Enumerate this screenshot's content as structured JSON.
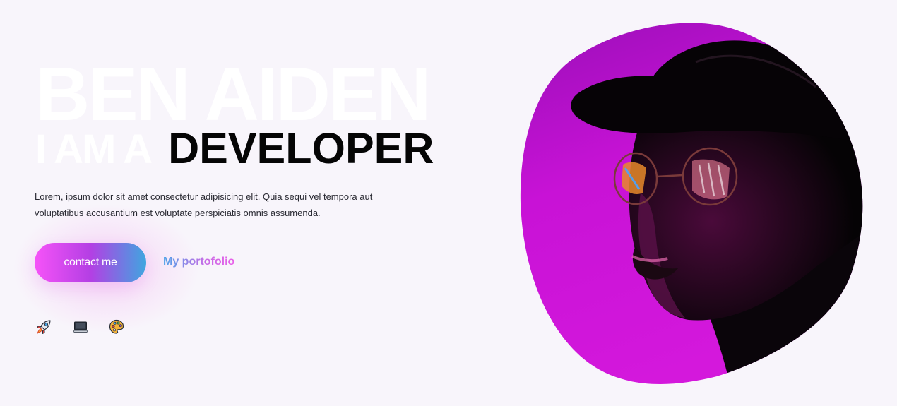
{
  "hero": {
    "name": "BEN AIDEN",
    "intro": "I AM A",
    "role": "DEVELOPER",
    "description": "Lorem, ipsum dolor sit amet consectetur adipisicing elit. Quia sequi vel tempora aut voluptatibus accusantium est voluptate perspiciatis omnis assumenda.",
    "contact_label": "contact me",
    "portfolio_label": "My portofolio"
  },
  "icons": [
    "rocket-icon",
    "laptop-icon",
    "palette-icon"
  ],
  "colors": {
    "background": "#f8f5fb",
    "gradient_pink": "#f653f8",
    "gradient_purple": "#b43fe4",
    "gradient_blue": "#3fa6e0",
    "portrait_magenta": "#c10fd3",
    "heading_dark": "#050505"
  }
}
